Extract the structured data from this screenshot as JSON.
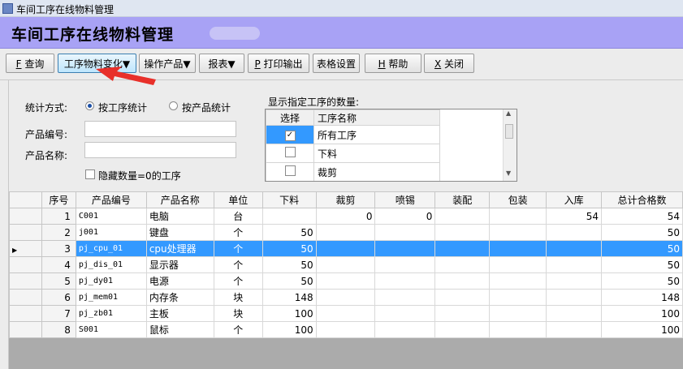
{
  "window": {
    "title": "车间工序在线物料管理"
  },
  "banner": {
    "title": "车间工序在线物料管理"
  },
  "toolbar": {
    "query": {
      "key": "F",
      "label": "查询"
    },
    "material_change": {
      "label": "工序物料变化▼"
    },
    "operate_product": {
      "label": "操作产品▼"
    },
    "report": {
      "label": "报表▼"
    },
    "print": {
      "key": "P",
      "label": "打印输出"
    },
    "table_settings": {
      "label": "表格设置"
    },
    "help": {
      "key": "H",
      "label": "帮助"
    },
    "close": {
      "key": "X",
      "label": "关闭"
    }
  },
  "filters": {
    "stat_mode_label": "统计方式:",
    "by_process": "按工序统计",
    "by_product": "按产品统计",
    "product_code_label": "产品编号:",
    "product_name_label": "产品名称:",
    "product_code_value": "",
    "product_name_value": "",
    "hide_zero_label": "隐藏数量=0的工序",
    "show_qty_label": "显示指定工序的数量:"
  },
  "process_list": {
    "headers": [
      "选择",
      "工序名称"
    ],
    "rows": [
      {
        "name": "所有工序",
        "checked": true
      },
      {
        "name": "下料",
        "checked": false
      },
      {
        "name": "裁剪",
        "checked": false
      }
    ]
  },
  "grid": {
    "columns": [
      "序号",
      "产品编号",
      "产品名称",
      "单位",
      "下料",
      "裁剪",
      "喷锡",
      "装配",
      "包装",
      "入库",
      "总计合格数"
    ],
    "rows": [
      {
        "row_no": "1",
        "code": "C001",
        "name": "电脑",
        "unit": "台",
        "xialiao": "",
        "caijian": "0",
        "penxi": "0",
        "zhuangpei": "",
        "baozhuang": "",
        "ruku": "54",
        "total": "54"
      },
      {
        "row_no": "2",
        "code": "j001",
        "name": "键盘",
        "unit": "个",
        "xialiao": "50",
        "caijian": "",
        "penxi": "",
        "zhuangpei": "",
        "baozhuang": "",
        "ruku": "",
        "total": "50"
      },
      {
        "row_no": "3",
        "code": "pj_cpu_01",
        "name": "cpu处理器",
        "unit": "个",
        "xialiao": "50",
        "caijian": "",
        "penxi": "",
        "zhuangpei": "",
        "baozhuang": "",
        "ruku": "",
        "total": "50"
      },
      {
        "row_no": "4",
        "code": "pj_dis_01",
        "name": "显示器",
        "unit": "个",
        "xialiao": "50",
        "caijian": "",
        "penxi": "",
        "zhuangpei": "",
        "baozhuang": "",
        "ruku": "",
        "total": "50"
      },
      {
        "row_no": "5",
        "code": "pj_dy01",
        "name": "电源",
        "unit": "个",
        "xialiao": "50",
        "caijian": "",
        "penxi": "",
        "zhuangpei": "",
        "baozhuang": "",
        "ruku": "",
        "total": "50"
      },
      {
        "row_no": "6",
        "code": "pj_mem01",
        "name": "内存条",
        "unit": "块",
        "xialiao": "148",
        "caijian": "",
        "penxi": "",
        "zhuangpei": "",
        "baozhuang": "",
        "ruku": "",
        "total": "148"
      },
      {
        "row_no": "7",
        "code": "pj_zb01",
        "name": "主板",
        "unit": "块",
        "xialiao": "100",
        "caijian": "",
        "penxi": "",
        "zhuangpei": "",
        "baozhuang": "",
        "ruku": "",
        "total": "100"
      },
      {
        "row_no": "8",
        "code": "S001",
        "name": "鼠标",
        "unit": "个",
        "xialiao": "100",
        "caijian": "",
        "penxi": "",
        "zhuangpei": "",
        "baozhuang": "",
        "ruku": "",
        "total": "100"
      }
    ]
  },
  "colors": {
    "banner": "#a8a2f5",
    "selection": "#3399ff",
    "annotation_arrow": "#e8302a"
  }
}
